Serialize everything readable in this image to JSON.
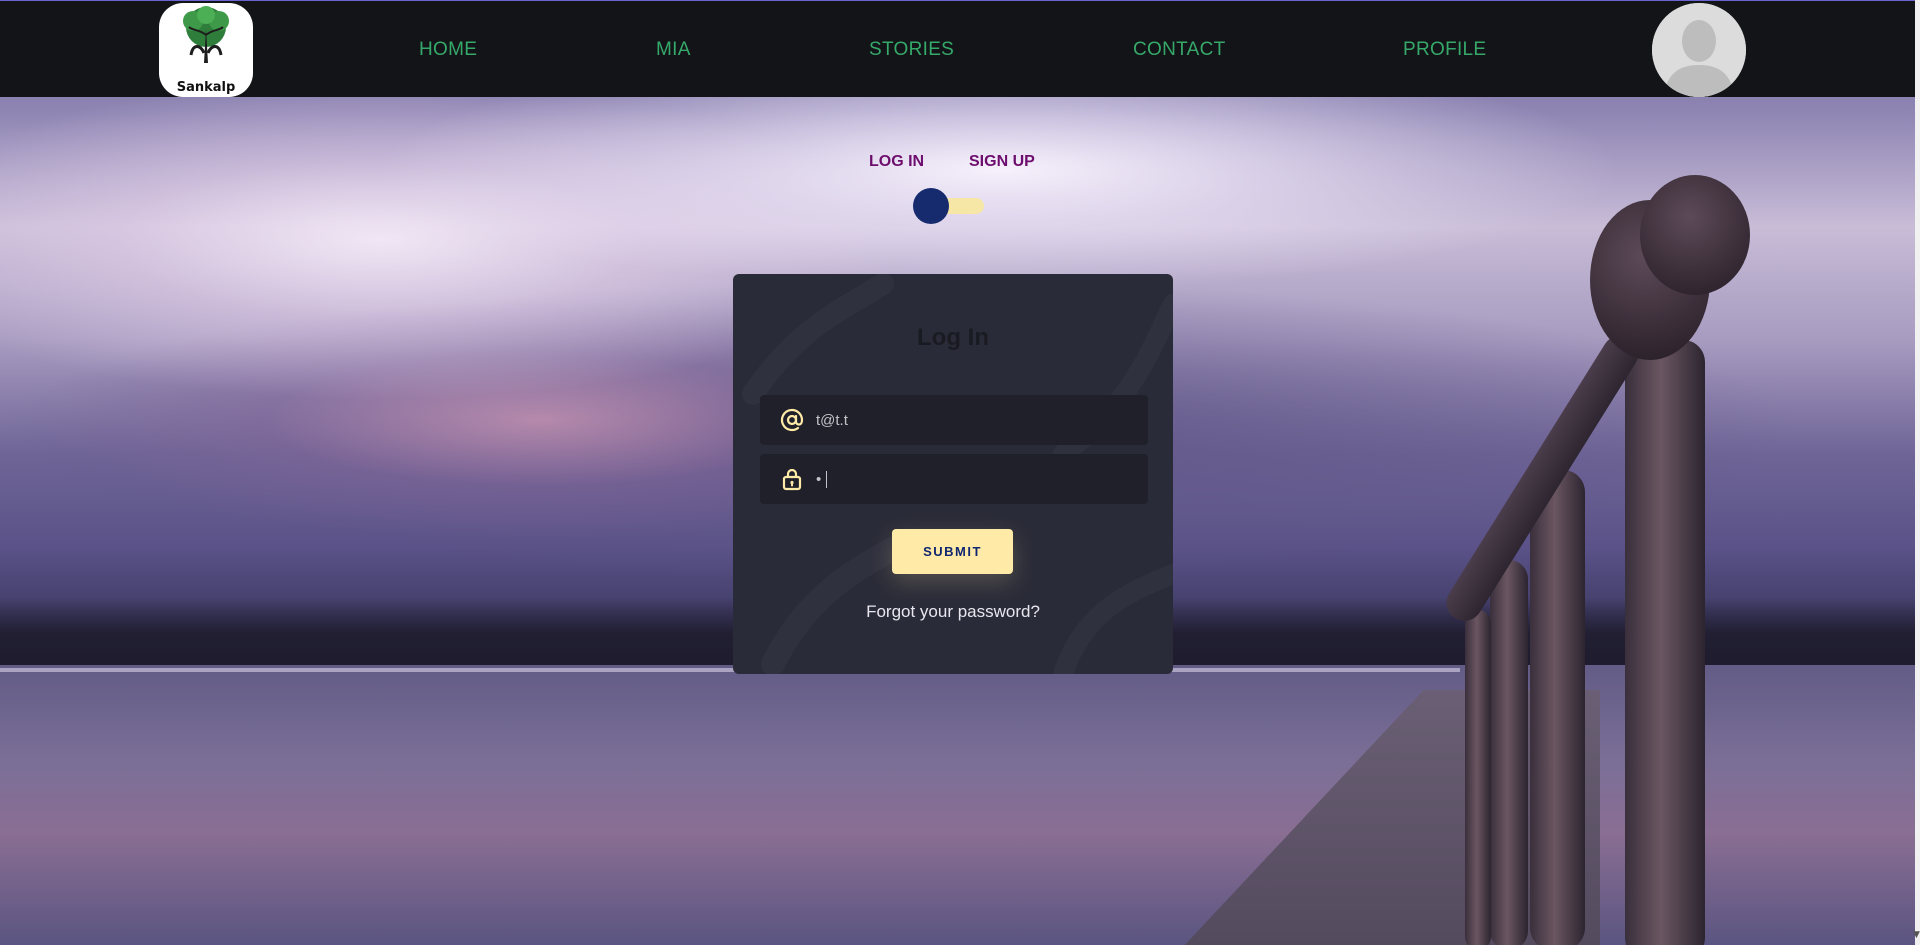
{
  "header": {
    "logo_text": "Sankalp",
    "nav": [
      "HOME",
      "MIA",
      "STORIES",
      "CONTACT",
      "PROFILE"
    ]
  },
  "auth_switch": {
    "login_label": "LOG IN",
    "signup_label": "SIGN UP",
    "selected": "LOG IN"
  },
  "login_card": {
    "title": "Log In",
    "email_value": "t@t.t",
    "password_value": "•",
    "submit_label": "SUBMIT",
    "forgot_label": "Forgot your password?"
  },
  "colors": {
    "nav_bg": "#121418",
    "nav_link": "#36a86a",
    "switch_label": "#6d0d6d",
    "card_bg": "#2a2b38",
    "input_bg": "#1f2029",
    "accent_yellow": "#ffeba7",
    "accent_blue": "#102770"
  },
  "icons": [
    "at-sign-icon",
    "lock-icon",
    "default-avatar-icon",
    "tree-logo-icon"
  ]
}
